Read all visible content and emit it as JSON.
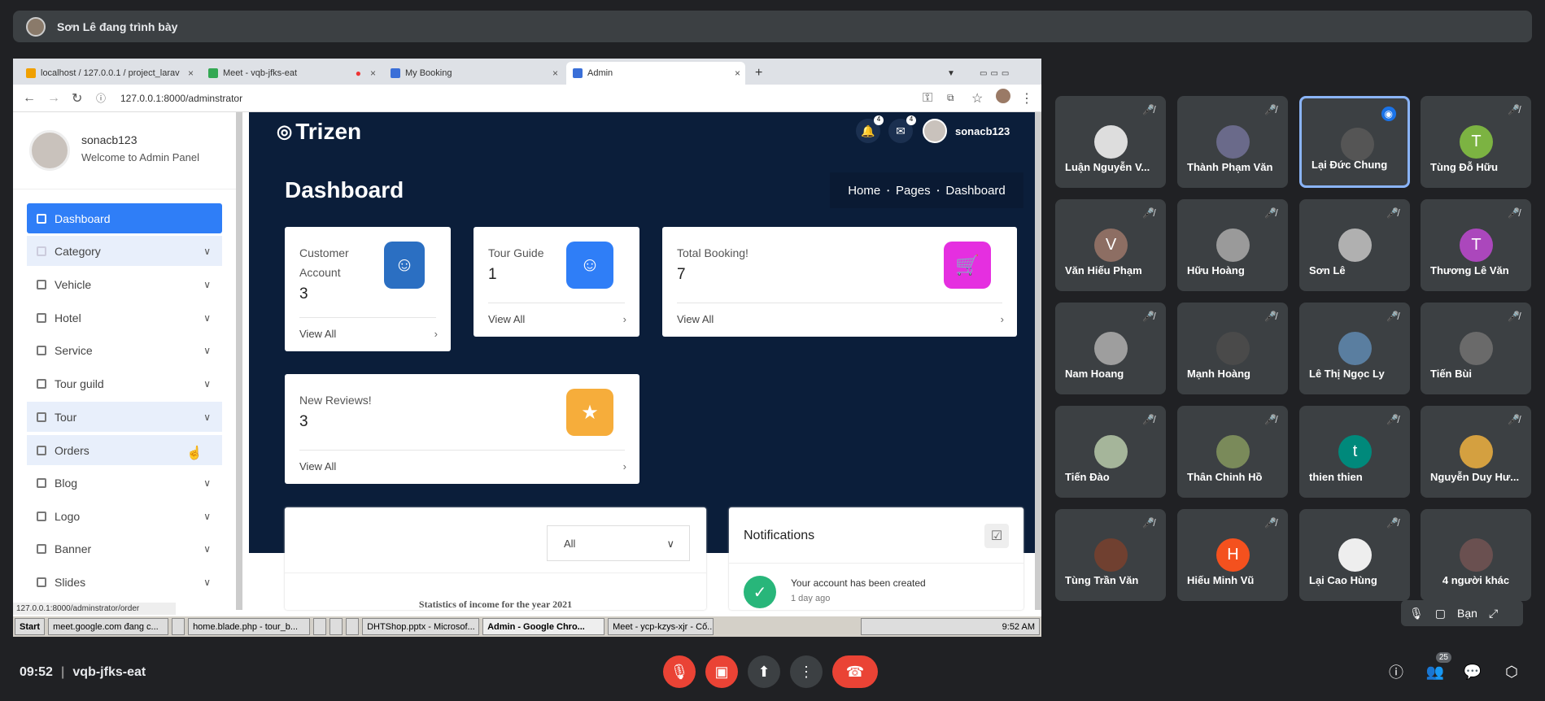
{
  "presenter": {
    "text": "Sơn Lê đang trình bày"
  },
  "browser": {
    "tabs": [
      "localhost / 127.0.0.1 / project_larav",
      "Meet - vqb-jfks-eat",
      "My Booking",
      "Admin"
    ],
    "url": "127.0.0.1:8000/adminstrator",
    "status_url": "127.0.0.1:8000/adminstrator/order"
  },
  "sidebar": {
    "username": "sonacb123",
    "welcome": "Welcome to Admin Panel",
    "items": [
      "Dashboard",
      "Category",
      "Vehicle",
      "Hotel",
      "Service",
      "Tour guild",
      "Tour",
      "Orders",
      "Blog",
      "Logo",
      "Banner",
      "Slides"
    ]
  },
  "header": {
    "brand": "Trizen",
    "user": "sonacb123",
    "notif_count": "4",
    "mail_count": "4"
  },
  "page": {
    "title": "Dashboard",
    "breadcrumb": [
      "Home",
      "Pages",
      "Dashboard"
    ]
  },
  "cards": [
    {
      "label": "Customer Account",
      "value": "3",
      "link": "View All",
      "color": "#2b6fc2"
    },
    {
      "label": "Tour Guide",
      "value": "1",
      "link": "View All",
      "color": "#2f7ef7"
    },
    {
      "label": "Total Booking!",
      "value": "7",
      "link": "View All",
      "color": "#e52fe0"
    },
    {
      "label": "New Reviews!",
      "value": "3",
      "link": "View All",
      "color": "#f6ad3b"
    }
  ],
  "stats": {
    "select": "All",
    "title": "Statistics of income for the year 2021"
  },
  "notifications": {
    "title": "Notifications",
    "item": "Your account has been created",
    "time": "1 day ago"
  },
  "taskbar": {
    "start": "Start",
    "items": [
      "meet.google.com đang c...",
      "home.blade.php - tour_b...",
      "DHTShop.pptx - Microsof...",
      "Admin - Google Chro...",
      "Meet - ycp-kzys-xjr - Cố..."
    ],
    "clock": "9:52 AM"
  },
  "participants": [
    "Luận Nguyễn V...",
    "Thành Phạm Văn",
    "Lại Đức Chung",
    "Tùng Đỗ Hữu",
    "Văn Hiếu Phạm",
    "Hữu Hoàng",
    "Sơn Lê",
    "Thương Lê Văn",
    "Nam Hoang",
    "Mạnh Hoàng",
    "Lê Thị Ngọc Ly",
    "Tiến Bùi",
    "Tiến Đào",
    "Thân Chinh Hồ",
    "thien thien",
    "Nguyễn Duy Hư...",
    "Tùng Trần Văn",
    "Hiếu Minh Vũ",
    "Lại Cao Hùng",
    "4 người khác"
  ],
  "avatar_letters": {
    "3": "T",
    "4": "V",
    "7": "T",
    "14": "t",
    "17": "H"
  },
  "self": {
    "label": "Bạn"
  },
  "meeting": {
    "time": "09:52",
    "code": "vqb-jfks-eat",
    "people_count": "25"
  }
}
